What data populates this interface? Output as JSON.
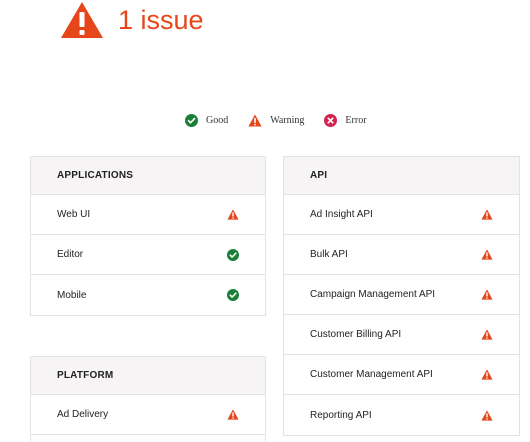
{
  "summary": {
    "text": "1 issue",
    "icon": "warning-icon",
    "color": "#e5471b"
  },
  "legend": [
    {
      "icon": "check-circle-icon",
      "label": "Good",
      "color": "#1a7f37"
    },
    {
      "icon": "warning-icon",
      "label": "Warning",
      "color": "#e5471b"
    },
    {
      "icon": "error-circle-icon",
      "label": "Error",
      "color": "#d6204e"
    }
  ],
  "panels": {
    "applications": {
      "title": "APPLICATIONS",
      "rows": [
        {
          "label": "Web UI",
          "status": "warning"
        },
        {
          "label": "Editor",
          "status": "good"
        },
        {
          "label": "Mobile",
          "status": "good"
        }
      ]
    },
    "api": {
      "title": "API",
      "rows": [
        {
          "label": "Ad Insight API",
          "status": "warning"
        },
        {
          "label": "Bulk API",
          "status": "warning"
        },
        {
          "label": "Campaign Management API",
          "status": "warning"
        },
        {
          "label": "Customer Billing API",
          "status": "warning"
        },
        {
          "label": "Customer Management API",
          "status": "warning"
        },
        {
          "label": "Reporting API",
          "status": "warning"
        }
      ]
    },
    "platform": {
      "title": "PLATFORM",
      "rows": [
        {
          "label": "Ad Delivery",
          "status": "warning"
        }
      ]
    }
  }
}
